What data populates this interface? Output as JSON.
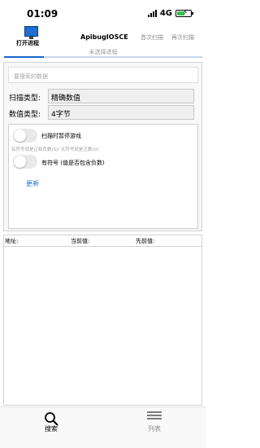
{
  "status_bar": {
    "time": "01:09",
    "network": "4G"
  },
  "header": {
    "open_process_label": "打开进程",
    "app_name": "ApibugIOSCE",
    "first_scan_label": "首次扫描",
    "rescan_label": "再次扫描"
  },
  "process_label": "未选择进程",
  "scan": {
    "search_placeholder": "要搜索的数据",
    "scan_type_label": "扫描类型:",
    "scan_type_value": "精确数值",
    "value_type_label": "数值类型:",
    "value_type_value": "4字节",
    "pause_game_label": "扫描时暂停游戏",
    "pause_game_on": false,
    "sign_hint": "有符号就是正和负数(S)/ 无符号就是正数(U)",
    "signed_label": "有符号 (值是否包含负数)",
    "signed_on": false,
    "update_label": "更新"
  },
  "results": {
    "columns": [
      "地址:",
      "当前值:",
      "先前值:"
    ]
  },
  "tabbar": {
    "search_label": "搜索",
    "list_label": "列表"
  },
  "colors": {
    "accent": "#1a66c8",
    "battery": "#33c24d"
  }
}
